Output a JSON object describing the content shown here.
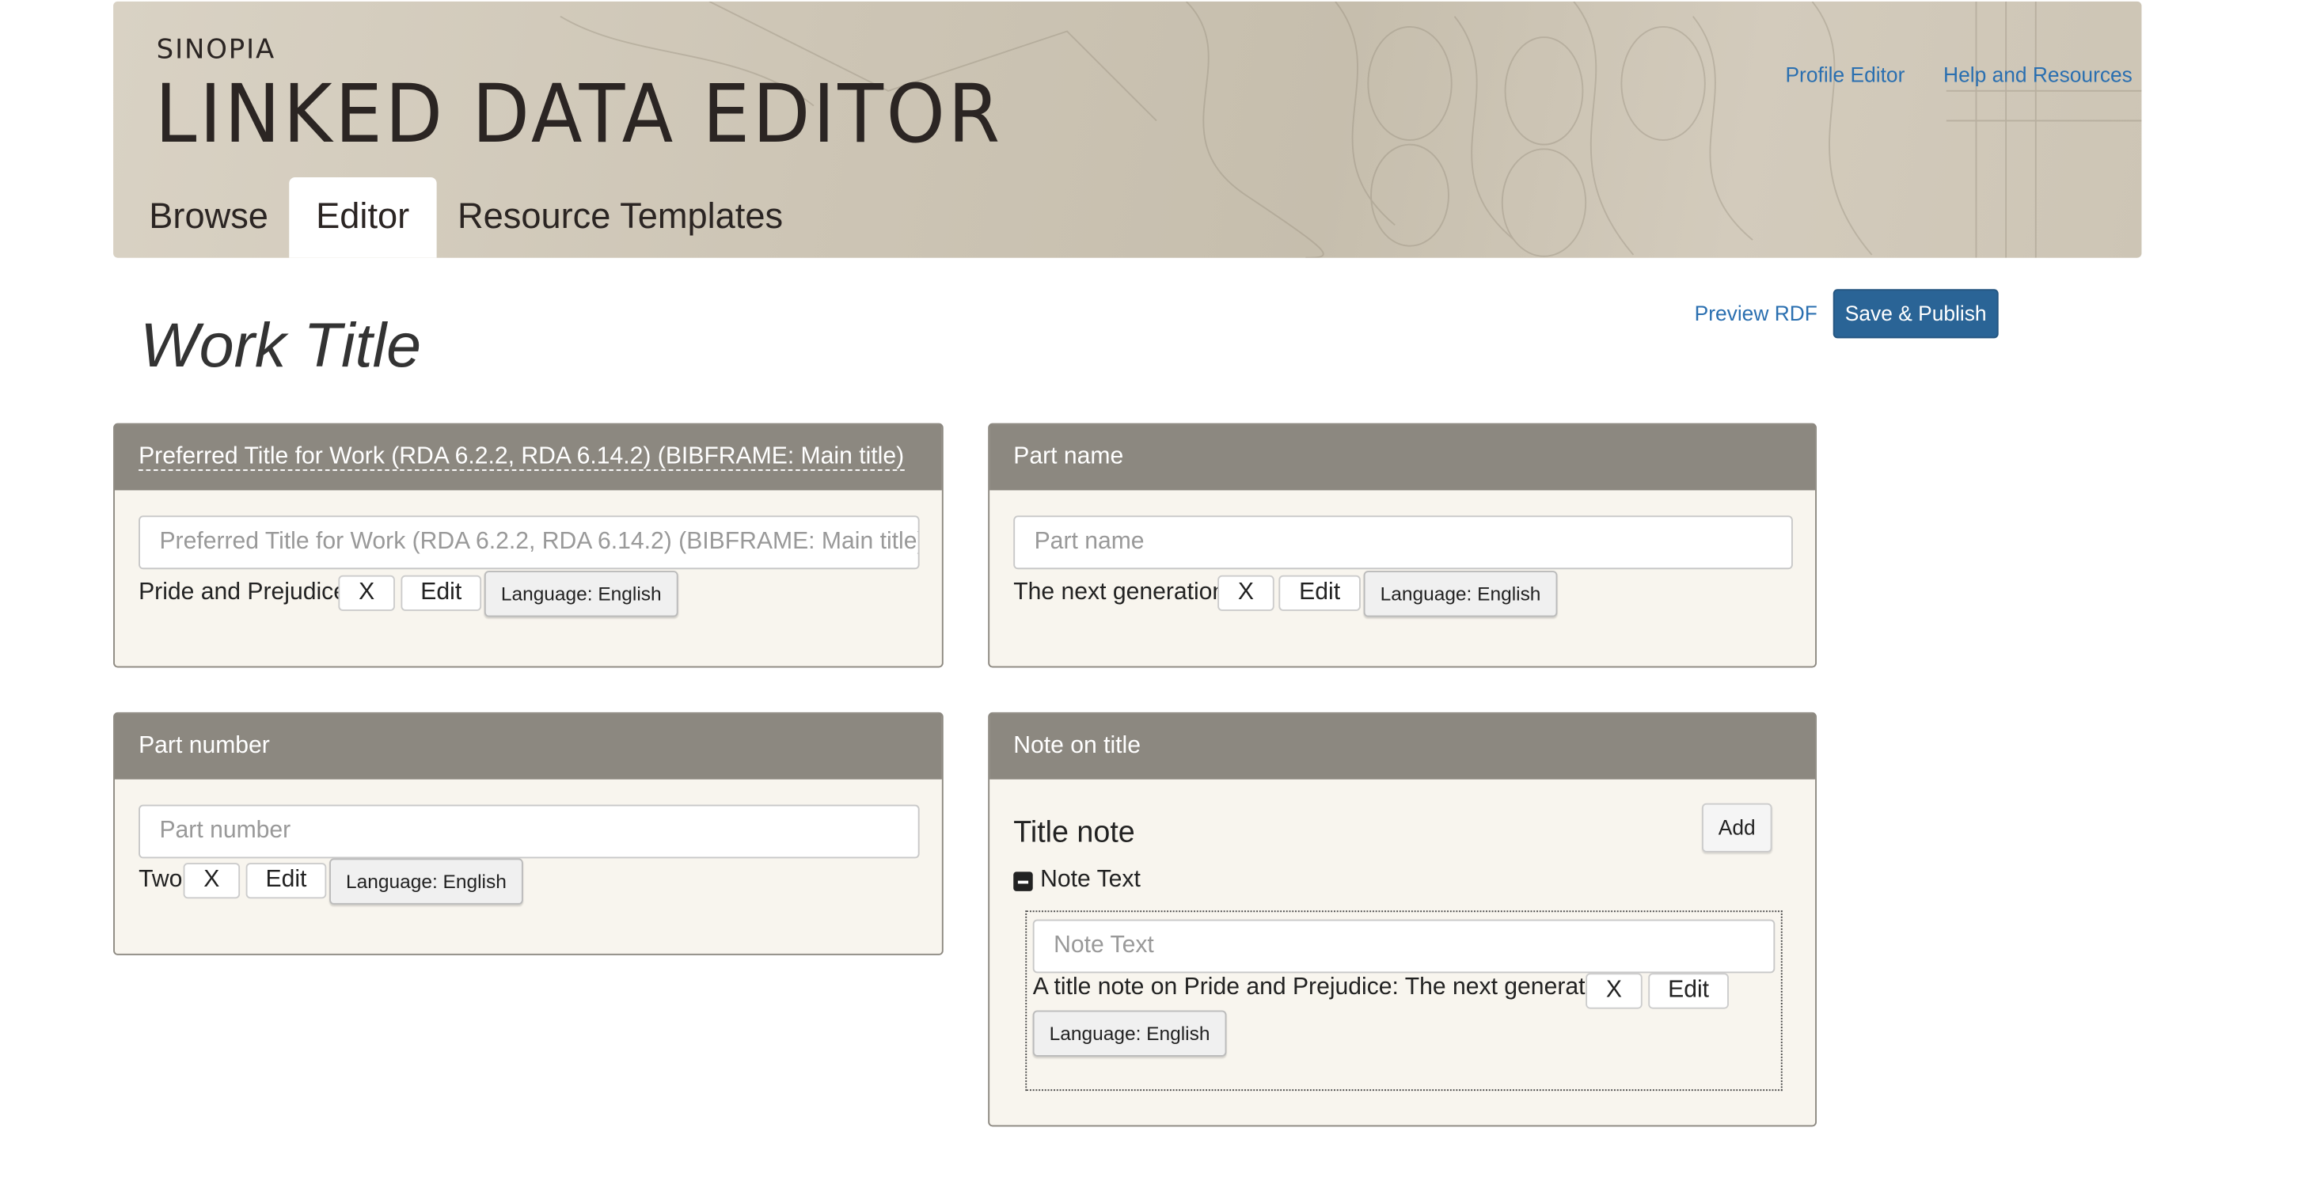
{
  "header": {
    "brand_small": "SINOPIA",
    "brand_big": "LINKED DATA EDITOR",
    "links": {
      "profile_editor": "Profile Editor",
      "help": "Help and Resources"
    },
    "tabs": [
      {
        "label": "Browse",
        "active": false
      },
      {
        "label": "Editor",
        "active": true
      },
      {
        "label": "Resource Templates",
        "active": false
      }
    ]
  },
  "toolbar": {
    "preview_label": "Preview RDF",
    "save_label": "Save & Publish"
  },
  "page": {
    "title": "Work Title"
  },
  "panels": {
    "preferred_title": {
      "heading": "Preferred Title for Work (RDA 6.2.2, RDA 6.14.2) (BIBFRAME: Main title)",
      "placeholder": "Preferred Title for Work (RDA 6.2.2, RDA 6.14.2) (BIBFRAME: Main title)",
      "value": "Pride and Prejudice",
      "remove_label": "X",
      "edit_label": "Edit",
      "language_label": "Language: English"
    },
    "part_name": {
      "heading": "Part name",
      "placeholder": "Part name",
      "value": "The next generation",
      "remove_label": "X",
      "edit_label": "Edit",
      "language_label": "Language: English"
    },
    "part_number": {
      "heading": "Part number",
      "placeholder": "Part number",
      "value": "Two",
      "remove_label": "X",
      "edit_label": "Edit",
      "language_label": "Language: English"
    },
    "note_on_title": {
      "heading": "Note on title",
      "subheading": "Title note",
      "add_label": "Add",
      "property_label": "Note Text",
      "placeholder": "Note Text",
      "value": "A title note on Pride and Prejudice: The next generation",
      "remove_label": "X",
      "edit_label": "Edit",
      "language_label": "Language: English"
    }
  },
  "colors": {
    "accent": "#2a6496",
    "link": "#2a6fb0",
    "panel_header": "#8c8880",
    "panel_body": "#f8f5ee"
  }
}
